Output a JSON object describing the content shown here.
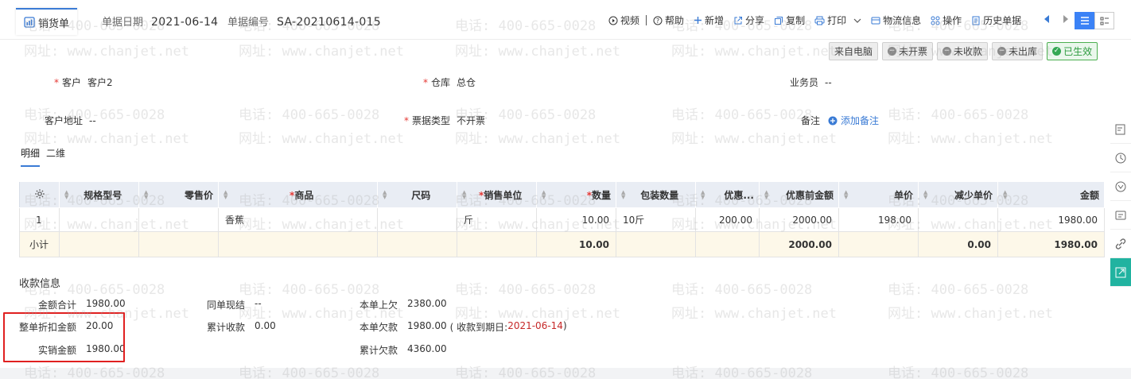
{
  "tab": {
    "title": "销货单",
    "icon": "sales-doc-icon"
  },
  "header": {
    "date_label": "单据日期",
    "date_value": "2021-06-14",
    "number_label": "单据编号",
    "number_value": "SA-20210614-015"
  },
  "toolbar": {
    "video": "视频",
    "help": "帮助",
    "new": "新增",
    "share": "分享",
    "copy": "复制",
    "print": "打印",
    "logistics": "物流信息",
    "operation": "操作",
    "history": "历史单据"
  },
  "badges": {
    "source": "来自电脑",
    "invoice": "未开票",
    "collect": "未收款",
    "outbound": "未出库",
    "effective": "已生效"
  },
  "form": {
    "customer_label": "客户",
    "customer_value": "客户2",
    "warehouse_label": "仓库",
    "warehouse_value": "总仓",
    "salesman_label": "业务员",
    "salesman_value": "--",
    "address_label": "客户地址",
    "address_value": "--",
    "ticket_label": "票据类型",
    "ticket_value": "不开票",
    "note_label": "备注",
    "note_add": "添加备注"
  },
  "subtabs": {
    "detail": "明细",
    "twod": "二维"
  },
  "table": {
    "headers": {
      "spec": "规格型号",
      "retail": "零售价",
      "product": "商品",
      "size": "尺码",
      "unit": "销售单位",
      "qty": "数量",
      "pack": "包装数量",
      "discount": "优惠...",
      "pre_amount": "优惠前金额",
      "price": "单价",
      "reduce": "减少单价",
      "amount": "金额"
    },
    "row": {
      "no": "1",
      "spec": "",
      "retail": "",
      "product": "香蕉",
      "size": "",
      "unit": "斤",
      "qty": "10.00",
      "pack": "10斤",
      "discount": "200.00",
      "pre_amount": "2000.00",
      "price": "198.00",
      "reduce": "",
      "amount": "1980.00"
    },
    "subtotal": {
      "label": "小计",
      "qty": "10.00",
      "pre_amount": "2000.00",
      "reduce": "0.00",
      "amount": "1980.00"
    }
  },
  "payment": {
    "title": "收款信息",
    "total_label": "金额合计",
    "total_value": "1980.00",
    "discount_label": "整单折扣金额",
    "discount_value": "20.00",
    "actual_label": "实销金额",
    "actual_value": "1980.00",
    "cash_label": "同单现结",
    "cash_value": "--",
    "accum_label": "累计收款",
    "accum_value": "0.00",
    "prev_label": "本单上欠",
    "prev_value": "2380.00",
    "owe_label": "本单欠款",
    "owe_value": "1980.00",
    "due_prefix": "( 收款到期日: ",
    "due_date": "2021-06-14",
    "due_suffix": " )",
    "total_owe_label": "累计欠款",
    "total_owe_value": "4360.00"
  },
  "watermark": {
    "phone": "电话: 400-665-0028",
    "site": "网址: www.chanjet.net"
  }
}
